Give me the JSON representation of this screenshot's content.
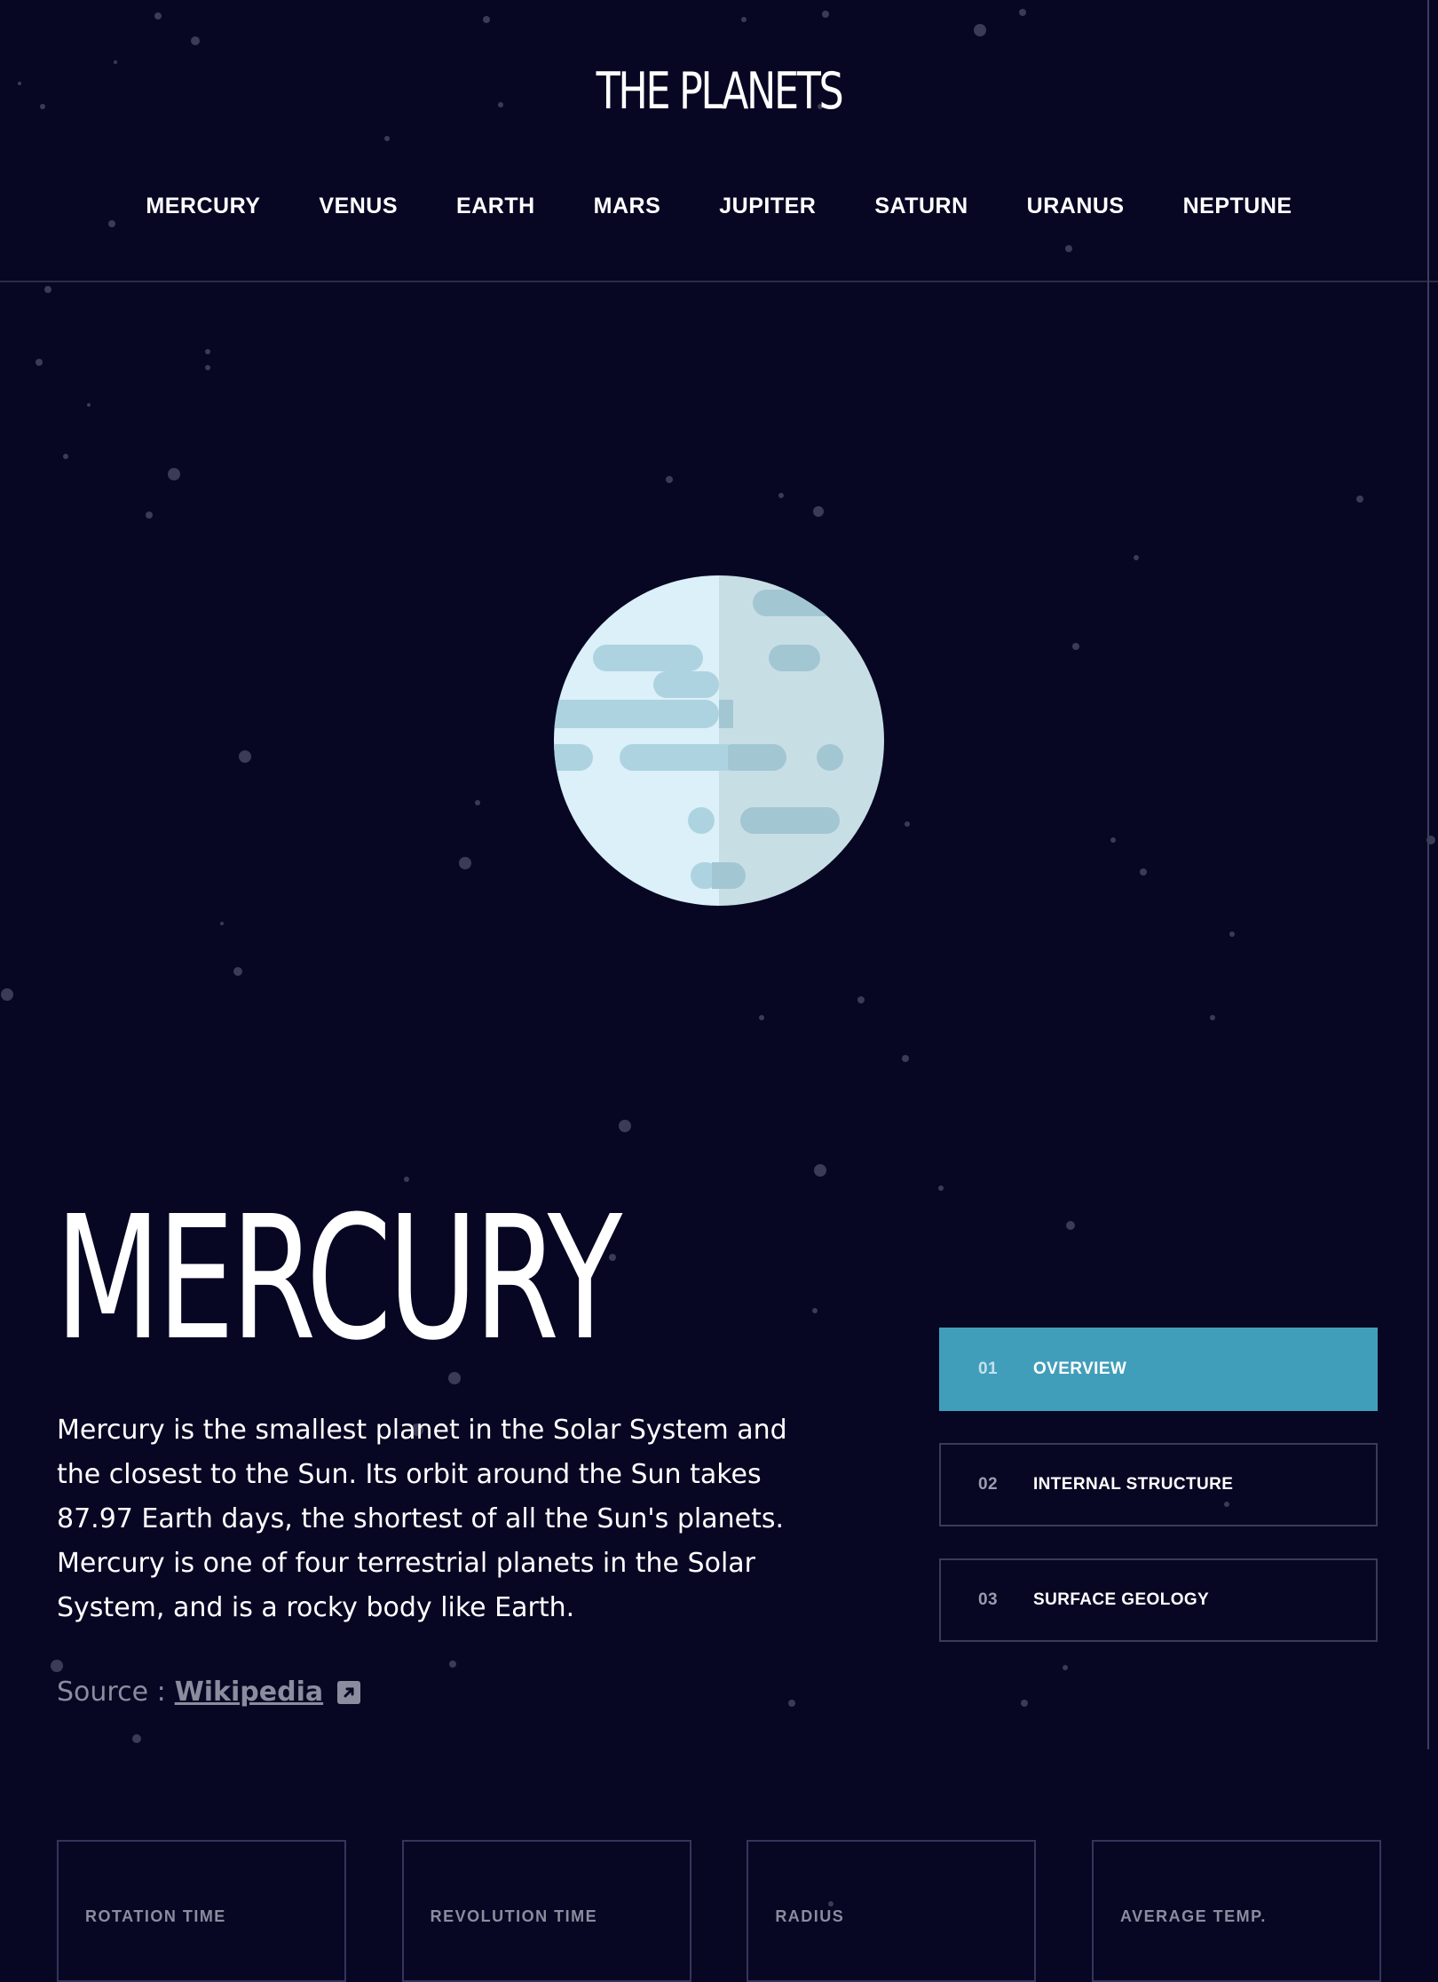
{
  "header": {
    "logo": "THE PLANETS",
    "nav": [
      "MERCURY",
      "VENUS",
      "EARTH",
      "MARS",
      "JUPITER",
      "SATURN",
      "URANUS",
      "NEPTUNE"
    ]
  },
  "planet": {
    "name": "MERCURY",
    "description": "Mercury is the smallest planet in the Solar System and the closest to the Sun. Its orbit around the Sun takes 87.97 Earth days, the shortest of all the Sun's planets. Mercury is one of four terrestrial planets in the Solar System, and is a rocky body like Earth.",
    "source_prefix": "Source :",
    "source_link": "Wikipedia"
  },
  "tabs": [
    {
      "num": "01",
      "label": "OVERVIEW",
      "active": true
    },
    {
      "num": "02",
      "label": "INTERNAL STRUCTURE",
      "active": false
    },
    {
      "num": "03",
      "label": "SURFACE GEOLOGY",
      "active": false
    }
  ],
  "stats": [
    {
      "label": "ROTATION TIME",
      "value": ""
    },
    {
      "label": "REVOLUTION TIME",
      "value": ""
    },
    {
      "label": "RADIUS",
      "value": ""
    },
    {
      "label": "AVERAGE TEMP.",
      "value": ""
    }
  ],
  "colors": {
    "background": "#070724",
    "accent": "#419EBB",
    "muted_text": "#8b8c9e",
    "border": "#34355a"
  },
  "icons": [
    "external-link-icon",
    "mercury-planet-illustration"
  ]
}
